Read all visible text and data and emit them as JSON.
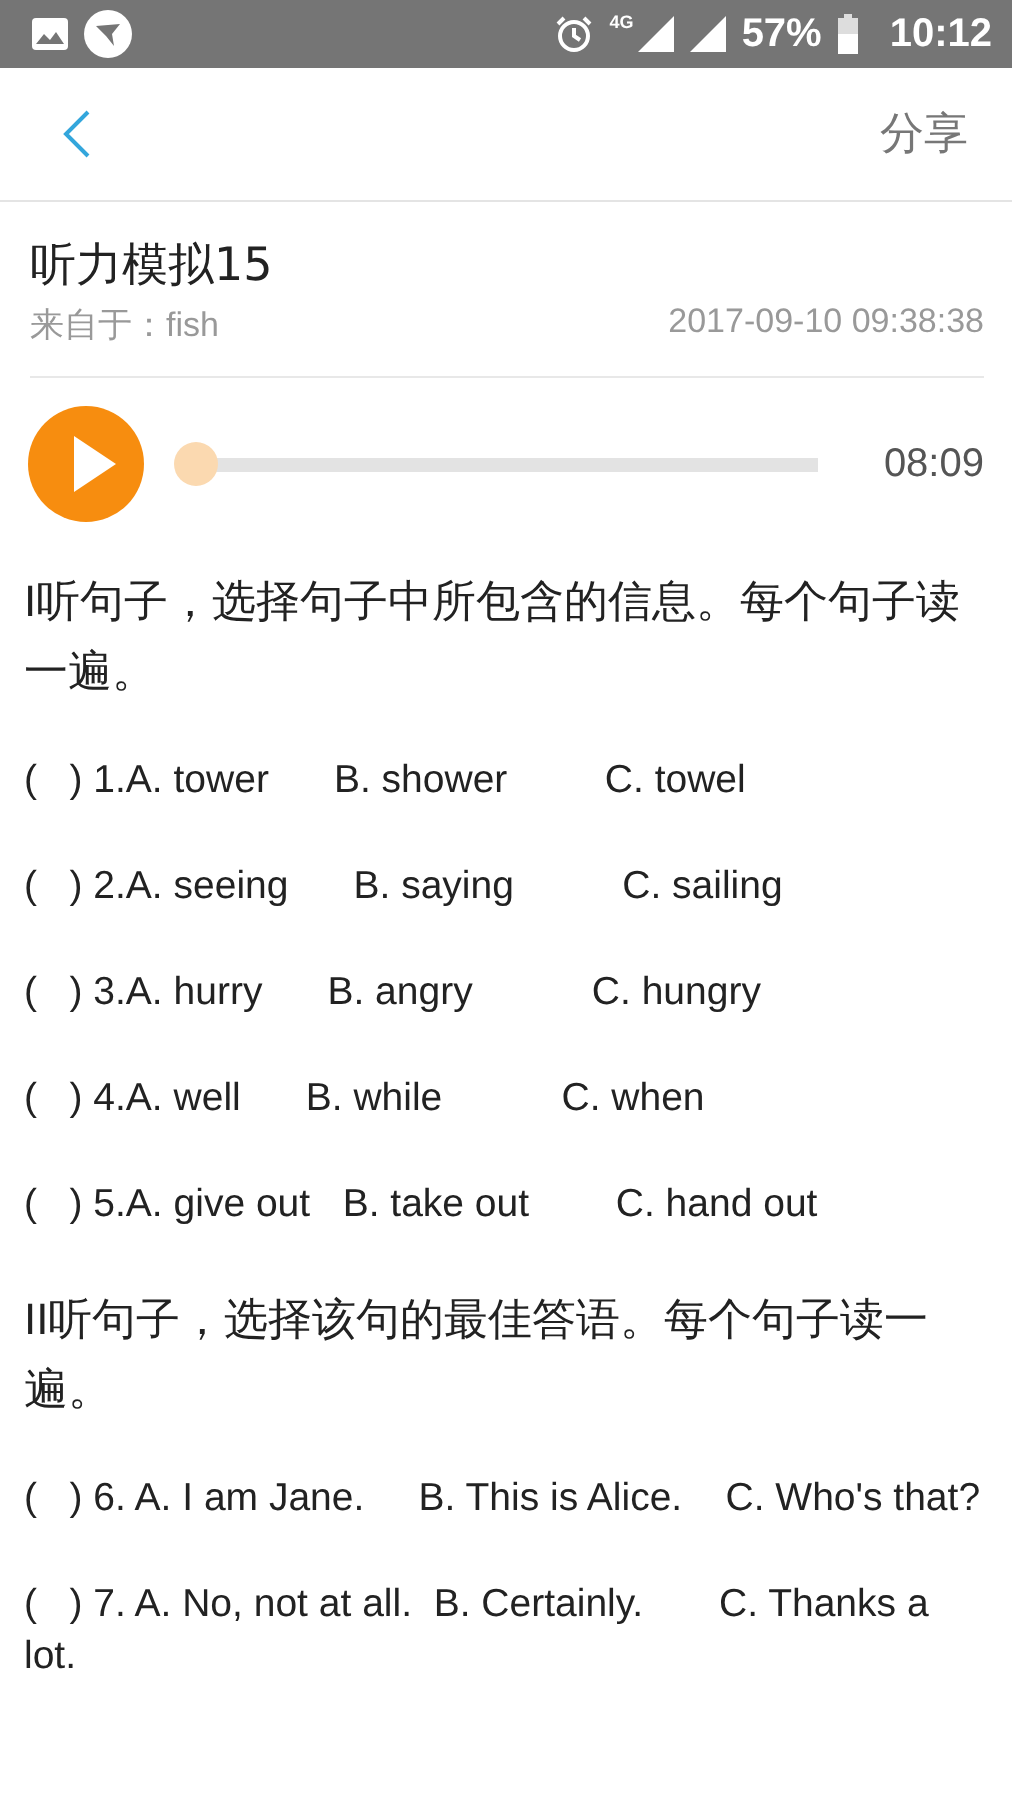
{
  "status_bar": {
    "network": "4G",
    "battery": "57%",
    "time": "10:12"
  },
  "header": {
    "action": "分享"
  },
  "article": {
    "title": "听力模拟15",
    "source": "来自于：fish",
    "date": "2017-09-10 09:38:38"
  },
  "player": {
    "playing": false,
    "level": 0,
    "duration": "08:09"
  },
  "content": [
    {
      "kind": "heading",
      "text": "I听句子，选择句子中所包含的信息。每个句子读一遍。"
    },
    {
      "kind": "question",
      "text": "(   ) 1.A. tower      B. shower         C. towel"
    },
    {
      "kind": "question",
      "text": "(   ) 2.A. seeing      B. saying          C. sailing"
    },
    {
      "kind": "question",
      "text": "(   ) 3.A. hurry      B. angry           C. hungry"
    },
    {
      "kind": "question",
      "text": "(   ) 4.A. well      B. while           C. when"
    },
    {
      "kind": "question",
      "text": "(   ) 5.A. give out   B. take out        C. hand out"
    },
    {
      "kind": "heading",
      "text": "II听句子，选择该句的最佳答语。每个句子读一遍。"
    },
    {
      "kind": "question",
      "text": "(   ) 6. A. I am Jane.     B. This is Alice.    C. Who's that?"
    },
    {
      "kind": "question",
      "text": "(   ) 7. A. No, not at all.  B. Certainly.       C. Thanks a lot."
    }
  ]
}
